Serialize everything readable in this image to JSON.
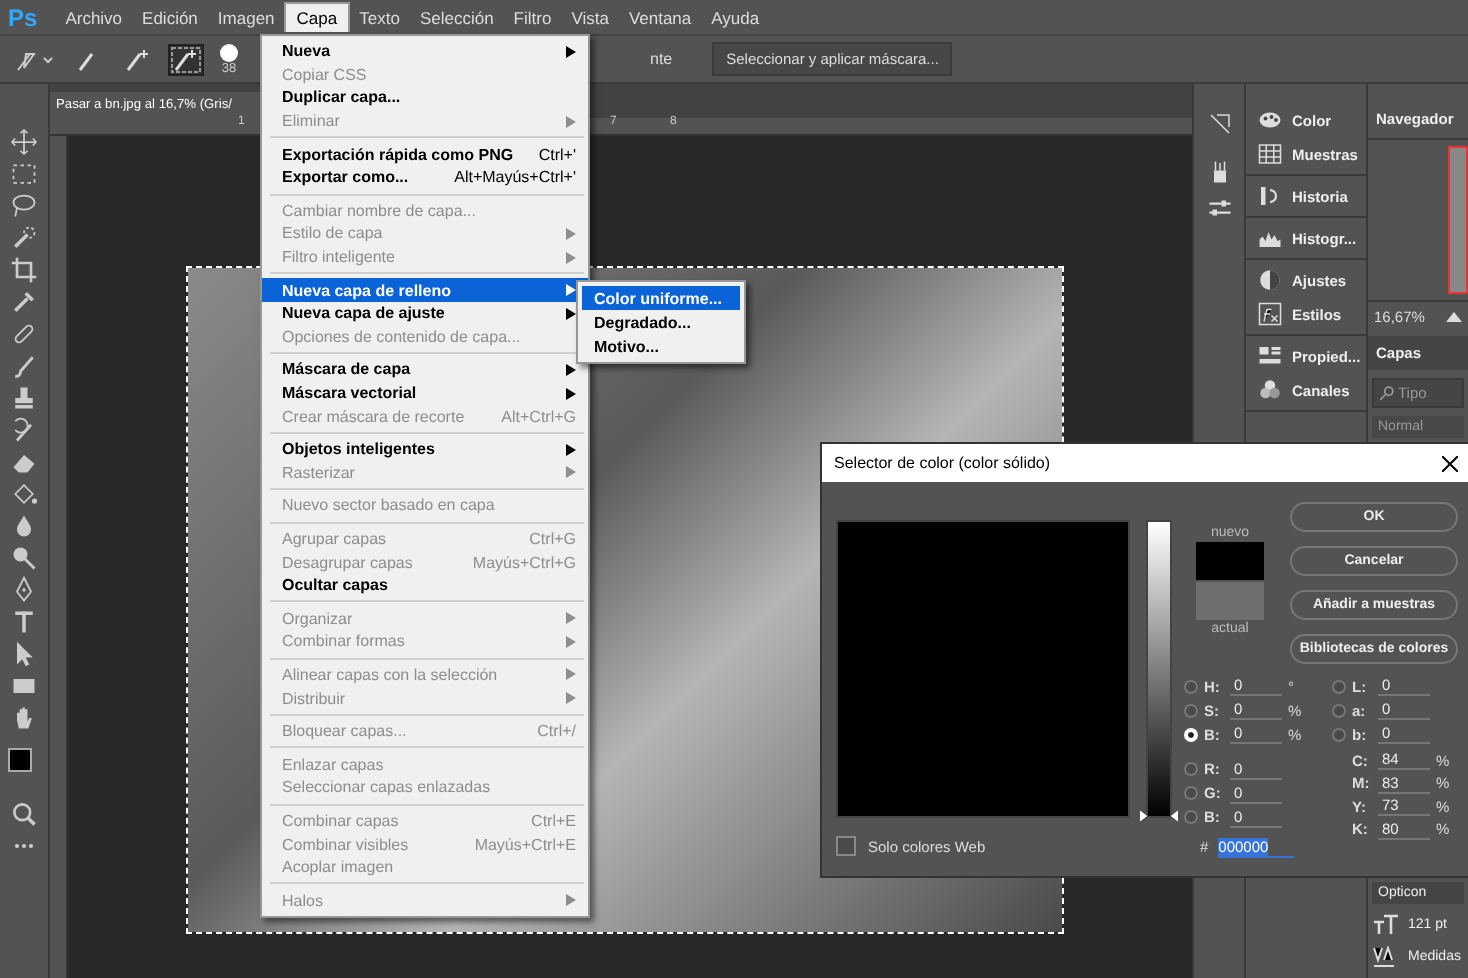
{
  "menubar": {
    "logo": "Ps",
    "items": [
      {
        "label": "Archivo",
        "selected": false
      },
      {
        "label": "Edición",
        "selected": false
      },
      {
        "label": "Imagen",
        "selected": false
      },
      {
        "label": "Capa",
        "selected": true
      },
      {
        "label": "Texto",
        "selected": false
      },
      {
        "label": "Selección",
        "selected": false
      },
      {
        "label": "Filtro",
        "selected": false
      },
      {
        "label": "Vista",
        "selected": false
      },
      {
        "label": "Ventana",
        "selected": false
      },
      {
        "label": "Ayuda",
        "selected": false
      }
    ]
  },
  "options_bar": {
    "brush_modes": [
      {
        "selected": false
      },
      {
        "selected": false
      },
      {
        "selected": true
      }
    ],
    "brush_size": "38",
    "partial_label": "nte",
    "mask_button": "Seleccionar y aplicar máscara..."
  },
  "document_tab": {
    "title": "Pasar a bn.jpg al 16,7% (Gris/"
  },
  "ruler_labels": [
    "1",
    "7",
    "8"
  ],
  "layer_menu": {
    "sections": [
      [
        {
          "label": "Nueva",
          "submenu": true,
          "disabled": false,
          "selected": false
        },
        {
          "label": "Copiar CSS",
          "submenu": false,
          "disabled": true,
          "selected": false
        },
        {
          "label": "Duplicar capa...",
          "submenu": false,
          "disabled": false,
          "selected": false
        },
        {
          "label": "Eliminar",
          "submenu": true,
          "disabled": true,
          "selected": false
        }
      ],
      [
        {
          "label": "Exportación rápida como PNG",
          "shortcut": "Ctrl+'",
          "submenu": false,
          "disabled": false,
          "selected": false
        },
        {
          "label": "Exportar como...",
          "shortcut": "Alt+Mayús+Ctrl+'",
          "submenu": false,
          "disabled": false,
          "selected": false
        }
      ],
      [
        {
          "label": "Cambiar nombre de capa...",
          "submenu": false,
          "disabled": true,
          "selected": false
        },
        {
          "label": "Estilo de capa",
          "submenu": true,
          "disabled": true,
          "selected": false
        },
        {
          "label": "Filtro inteligente",
          "submenu": true,
          "disabled": true,
          "selected": false
        }
      ],
      [
        {
          "label": "Nueva capa de relleno",
          "submenu": true,
          "disabled": false,
          "selected": true
        },
        {
          "label": "Nueva capa de ajuste",
          "submenu": true,
          "disabled": false,
          "selected": false
        },
        {
          "label": "Opciones de contenido de capa...",
          "submenu": false,
          "disabled": true,
          "selected": false
        }
      ],
      [
        {
          "label": "Máscara de capa",
          "submenu": true,
          "disabled": false,
          "selected": false
        },
        {
          "label": "Máscara vectorial",
          "submenu": true,
          "disabled": false,
          "selected": false
        },
        {
          "label": "Crear máscara de recorte",
          "shortcut": "Alt+Ctrl+G",
          "submenu": false,
          "disabled": true,
          "selected": false
        }
      ],
      [
        {
          "label": "Objetos inteligentes",
          "submenu": true,
          "disabled": false,
          "selected": false
        },
        {
          "label": "Rasterizar",
          "submenu": true,
          "disabled": true,
          "selected": false
        }
      ],
      [
        {
          "label": "Nuevo sector basado en capa",
          "submenu": false,
          "disabled": true,
          "selected": false
        }
      ],
      [
        {
          "label": "Agrupar capas",
          "shortcut": "Ctrl+G",
          "submenu": false,
          "disabled": true,
          "selected": false
        },
        {
          "label": "Desagrupar capas",
          "shortcut": "Mayús+Ctrl+G",
          "submenu": false,
          "disabled": true,
          "selected": false
        },
        {
          "label": "Ocultar capas",
          "submenu": false,
          "disabled": false,
          "selected": false
        }
      ],
      [
        {
          "label": "Organizar",
          "submenu": true,
          "disabled": true,
          "selected": false
        },
        {
          "label": "Combinar formas",
          "submenu": true,
          "disabled": true,
          "selected": false
        }
      ],
      [
        {
          "label": "Alinear capas con la selección",
          "submenu": true,
          "disabled": true,
          "selected": false
        },
        {
          "label": "Distribuir",
          "submenu": true,
          "disabled": true,
          "selected": false
        }
      ],
      [
        {
          "label": "Bloquear capas...",
          "shortcut": "Ctrl+/",
          "submenu": false,
          "disabled": true,
          "selected": false
        }
      ],
      [
        {
          "label": "Enlazar capas",
          "submenu": false,
          "disabled": true,
          "selected": false
        },
        {
          "label": "Seleccionar capas enlazadas",
          "submenu": false,
          "disabled": true,
          "selected": false
        }
      ],
      [
        {
          "label": "Combinar capas",
          "shortcut": "Ctrl+E",
          "submenu": false,
          "disabled": true,
          "selected": false
        },
        {
          "label": "Combinar visibles",
          "shortcut": "Mayús+Ctrl+E",
          "submenu": false,
          "disabled": true,
          "selected": false
        },
        {
          "label": "Acoplar imagen",
          "submenu": false,
          "disabled": true,
          "selected": false
        }
      ],
      [
        {
          "label": "Halos",
          "submenu": true,
          "disabled": true,
          "selected": false
        }
      ]
    ]
  },
  "fill_submenu": [
    {
      "label": "Color uniforme...",
      "selected": true
    },
    {
      "label": "Degradado...",
      "selected": false
    },
    {
      "label": "Motivo...",
      "selected": false
    }
  ],
  "panel_groups": [
    [
      {
        "label": "Color"
      },
      {
        "label": "Muestras"
      }
    ],
    [
      {
        "label": "Historia"
      }
    ],
    [
      {
        "label": "Histogr..."
      }
    ],
    [
      {
        "label": "Ajustes"
      },
      {
        "label": "Estilos"
      }
    ],
    [
      {
        "label": "Propied..."
      },
      {
        "label": "Canales"
      }
    ]
  ],
  "navigator": {
    "tab": "Navegador",
    "zoom": "16,67%"
  },
  "layers": {
    "tab": "Capas",
    "search_placeholder": "Tipo",
    "blend_mode": "Normal"
  },
  "character": {
    "font": "Opticon",
    "size": "121 pt",
    "kerning": "Medidas"
  },
  "color_picker": {
    "title": "Selector de color (color sólido)",
    "new_label": "nuevo",
    "current_label": "actual",
    "brightness_slider": {
      "level": 0
    },
    "buttons": [
      "OK",
      "Cancelar",
      "Añadir a muestras",
      "Bibliotecas de colores"
    ],
    "web_only": {
      "label": "Solo colores Web",
      "checked": false
    },
    "hsb": [
      {
        "label": "H:",
        "value": "0",
        "unit": "°",
        "selected": false
      },
      {
        "label": "S:",
        "value": "0",
        "unit": "%",
        "selected": false
      },
      {
        "label": "B:",
        "value": "0",
        "unit": "%",
        "selected": true
      }
    ],
    "rgb": [
      {
        "label": "R:",
        "value": "0",
        "selected": false
      },
      {
        "label": "G:",
        "value": "0",
        "selected": false
      },
      {
        "label": "B:",
        "value": "0",
        "selected": false
      }
    ],
    "lab": [
      {
        "label": "L:",
        "value": "0",
        "selected": false
      },
      {
        "label": "a:",
        "value": "0",
        "selected": false
      },
      {
        "label": "b:",
        "value": "0",
        "selected": false
      }
    ],
    "cmyk": [
      {
        "label": "C:",
        "value": "84",
        "unit": "%"
      },
      {
        "label": "M:",
        "value": "83",
        "unit": "%"
      },
      {
        "label": "Y:",
        "value": "73",
        "unit": "%"
      },
      {
        "label": "K:",
        "value": "80",
        "unit": "%"
      }
    ],
    "hex_label": "#",
    "hex": "000000"
  }
}
